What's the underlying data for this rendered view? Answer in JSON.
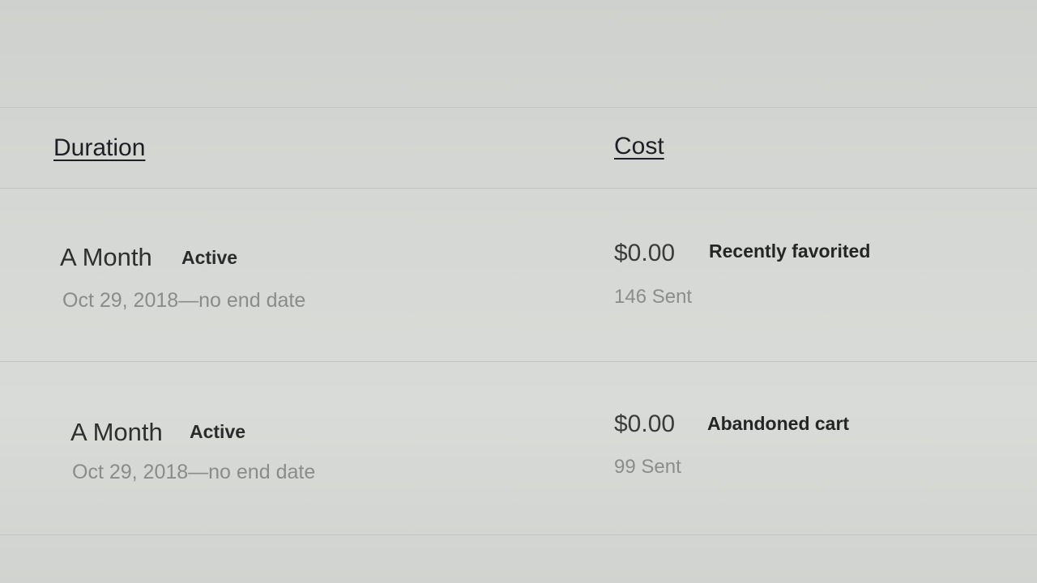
{
  "table": {
    "headers": {
      "duration": "Duration",
      "cost": "Cost"
    },
    "rows": [
      {
        "duration": "A Month",
        "status": "Active",
        "date_range": "Oct 29, 2018—no end date",
        "cost": "$0.00",
        "type": "Recently favorited",
        "sent": "146 Sent"
      },
      {
        "duration": "A Month",
        "status": "Active",
        "date_range": "Oct 29, 2018—no end date",
        "cost": "$0.00",
        "type": "Abandoned cart",
        "sent": "99 Sent"
      }
    ]
  }
}
